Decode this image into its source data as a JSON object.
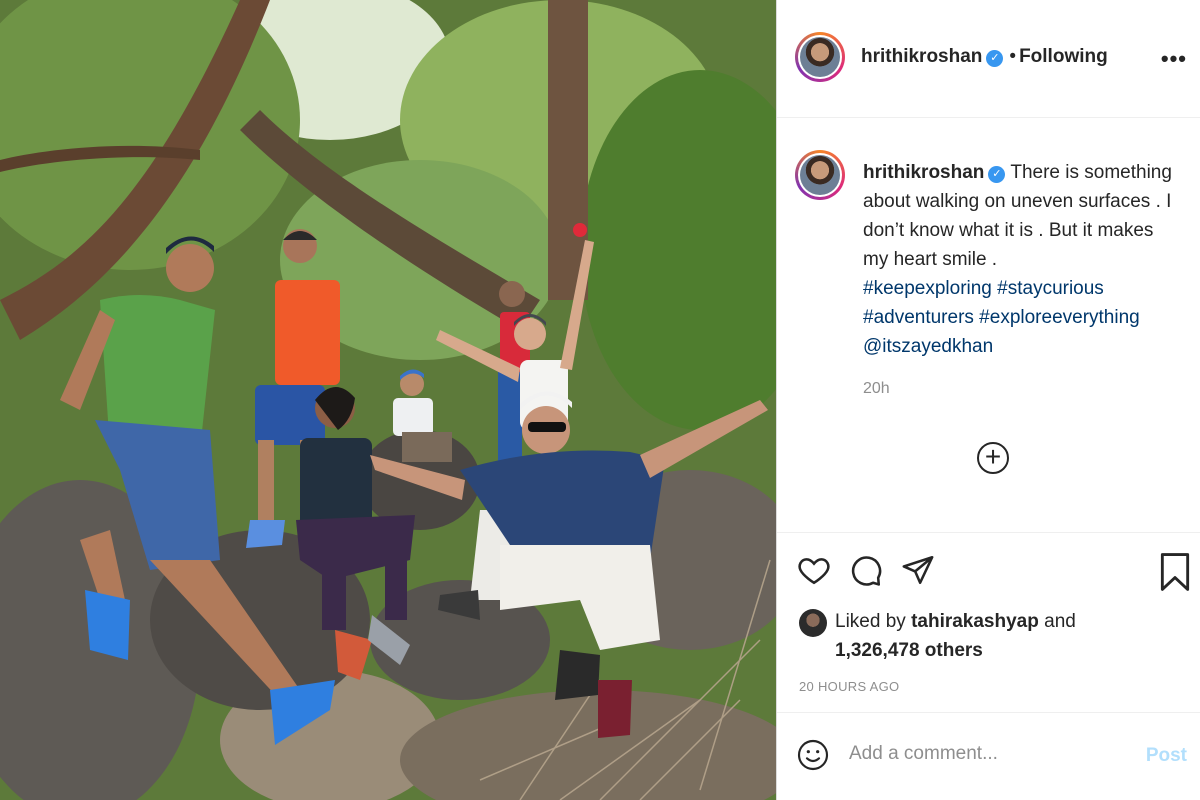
{
  "post": {
    "username": "hrithikroshan",
    "follow_status": "Following",
    "more_label": "•••",
    "caption": {
      "username": "hrithikroshan",
      "text": "There is something about walking on uneven surfaces . I don’t know what it is . But it makes my heart smile .",
      "hashtags_line1": "#keepexploring #staycurious",
      "hashtags_line2": "#adventurers #exploreeverything",
      "mention": "@itszayedkhan"
    },
    "timestamp": "20h",
    "add_label": "+",
    "likes": {
      "prefix": "Liked by",
      "liker": "tahirakashyap",
      "connector": "and",
      "count": "1,326,478 others"
    },
    "post_age": "20 HOURS AGO",
    "comment": {
      "placeholder": "Add a comment...",
      "post_label": "Post"
    }
  },
  "colors": {
    "link": "#00376b",
    "verified": "#3897f0",
    "muted": "#8e8e8e",
    "post_disabled": "#b2dffc"
  },
  "icons": [
    "heart-icon",
    "comment-icon",
    "share-icon",
    "bookmark-icon",
    "emoji-icon",
    "verified-icon",
    "more-icon",
    "add-icon"
  ]
}
